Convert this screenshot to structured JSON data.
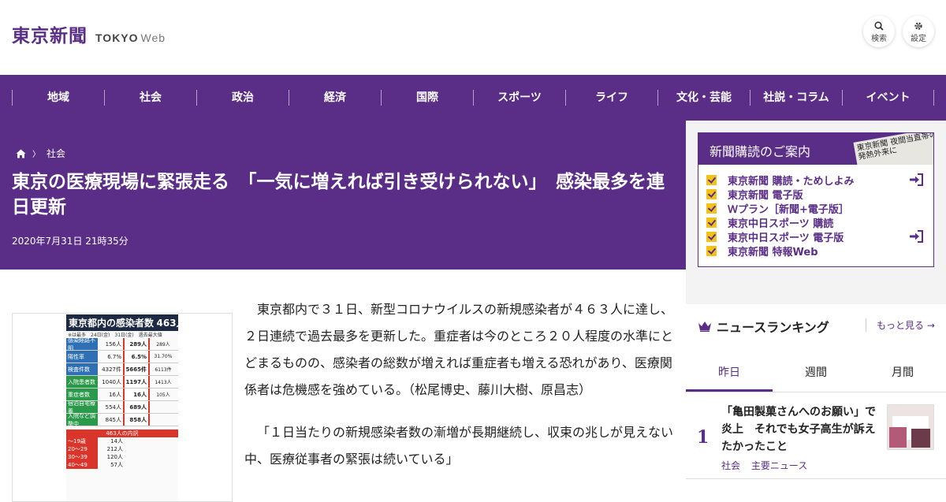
{
  "header": {
    "logo_main": "東京新聞",
    "logo_sub": "TOKYO",
    "logo_web": "Web",
    "search_label": "検索",
    "settings_label": "設定"
  },
  "nav": {
    "items": [
      "地域",
      "社会",
      "政治",
      "経済",
      "国際",
      "スポーツ",
      "ライフ",
      "文化・芸能",
      "社説・コラム",
      "イベント"
    ]
  },
  "article": {
    "breadcrumb_section": "社会",
    "title": "東京の医療現場に緊張走る　「一気に増えれば引き受けられない」　感染最多を連日更新",
    "date": "2020年7月31日 21時35分",
    "paragraphs": [
      "東京都内で３１日、新型コロナウイルスの新規感染者が４６３人に達し、２日連続で過去最多を更新した。重症者は今のところ２０人程度の水準にとどまるものの、感染者の総数が増えれば重症者も増える恐れがあり、医療関係者は危機感を強めている。（松尾博史、藤川大樹、原昌志）",
      "「１日当たりの新規感染者数の漸増が長期継続し、収束の兆しが見えない中、医療従事者の緊張は続いている」"
    ]
  },
  "figure": {
    "title": "東京都内の感染者数",
    "title_count": "463人",
    "note": "※は最多",
    "col_24": "24日(金)",
    "col_31": "31日(金)",
    "col_past": "過去最大値",
    "rows": [
      {
        "label": "感染経路不明",
        "v24": "156人",
        "v31": "289人",
        "past": "289人"
      },
      {
        "label": "陽性率",
        "v24": "6.7%",
        "v31": "6.5%",
        "past": "31.70%"
      },
      {
        "label": "検査件数",
        "v24": "4327件",
        "v31": "5665件",
        "past": "6113件"
      },
      {
        "label": "入院患者数",
        "v24": "1040人",
        "v31": "1197人",
        "past": "1413人"
      },
      {
        "label": "重症者数",
        "v24": "16人",
        "v31": "16人",
        "past": "105人"
      },
      {
        "label": "宿泊自宅療養",
        "v24": "554人",
        "v31": "689人",
        "past": ""
      },
      {
        "label": "入院など調整中",
        "v24": "845人",
        "v31": "858人",
        "past": ""
      }
    ],
    "breakdown_title": "463人の内訳",
    "ages": [
      {
        "age": "〜19歳",
        "count": "14人"
      },
      {
        "age": "20〜29",
        "count": "212人"
      },
      {
        "age": "30〜39",
        "count": "120人"
      },
      {
        "age": "40〜49",
        "count": "57人"
      }
    ]
  },
  "subscription": {
    "heading": "新聞購読のご案内",
    "paper_text": "東京新聞 夜間当直帯の発熱外来に",
    "items": [
      {
        "label": "東京新聞 購読・ためしよみ",
        "login": true
      },
      {
        "label": "東京新聞 電子版",
        "login": true
      },
      {
        "label": "Ｗプラン［新聞+電子版］",
        "login": false
      },
      {
        "label": "東京中日スポーツ 購読",
        "login": false
      },
      {
        "label": "東京中日スポーツ 電子版",
        "login": true
      },
      {
        "label": "東京新聞 特報Web",
        "login": false
      }
    ]
  },
  "ranking": {
    "heading": "ニュースランキング",
    "more": "もっと見る",
    "tabs": [
      "昨日",
      "週間",
      "月間"
    ],
    "items": [
      {
        "rank": "1",
        "title": "「亀田製菓さんへのお願い」で炎上　それでも女子高生が訴えたかったこと",
        "tags": [
          "社会",
          "主要ニュース"
        ]
      }
    ]
  },
  "colors": {
    "brand": "#5a2d87",
    "check": "#f2c21a",
    "sidebar_bg": "#f3f3f3"
  }
}
